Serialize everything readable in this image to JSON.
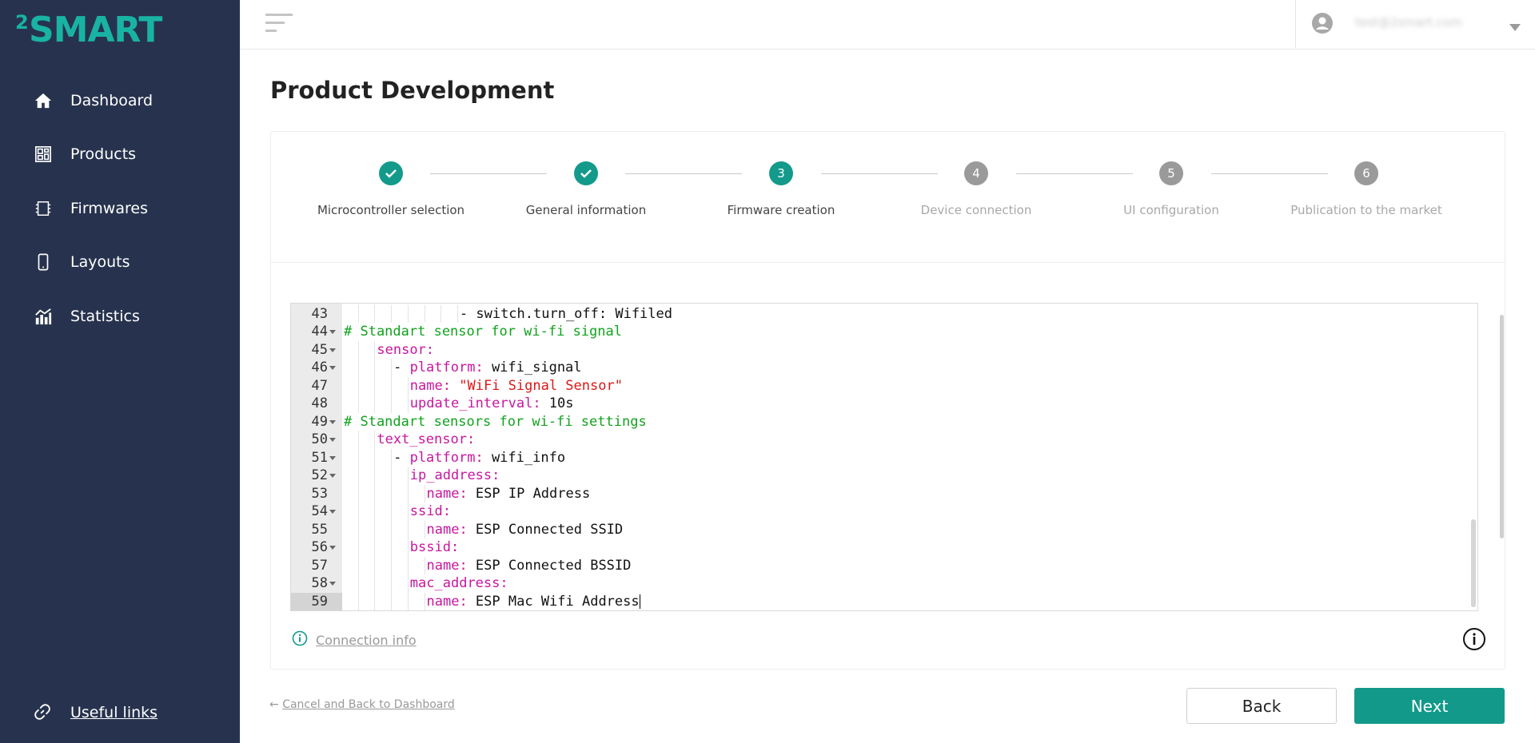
{
  "brand": {
    "superscript": "2",
    "name": "SMART",
    "accent": "#19b3a3"
  },
  "sidebar": {
    "items": [
      {
        "label": "Dashboard",
        "icon": "home-icon"
      },
      {
        "label": "Products",
        "icon": "products-icon"
      },
      {
        "label": "Firmwares",
        "icon": "chip-icon"
      },
      {
        "label": "Layouts",
        "icon": "phone-icon"
      },
      {
        "label": "Statistics",
        "icon": "chart-icon"
      }
    ],
    "footer_link": {
      "label": "Useful links",
      "icon": "link-icon"
    }
  },
  "header": {
    "user_email": "test@2smart.com"
  },
  "page": {
    "title": "Product Development"
  },
  "stepper": {
    "steps": [
      {
        "number": "1",
        "label": "Microcontroller selection",
        "state": "done"
      },
      {
        "number": "2",
        "label": "General information",
        "state": "done"
      },
      {
        "number": "3",
        "label": "Firmware creation",
        "state": "active"
      },
      {
        "number": "4",
        "label": "Device connection",
        "state": "pending"
      },
      {
        "number": "5",
        "label": "UI configuration",
        "state": "pending"
      },
      {
        "number": "6",
        "label": "Publication to the market",
        "state": "pending"
      }
    ]
  },
  "editor": {
    "lines": [
      {
        "n": "43",
        "fold": false,
        "indent": 7,
        "tokens": [
          [
            "plain",
            "- switch.turn_off: Wifiled"
          ]
        ]
      },
      {
        "n": "44",
        "fold": true,
        "indent": 0,
        "tokens": [
          [
            "comment",
            "# Standart sensor for wi-fi signal"
          ]
        ]
      },
      {
        "n": "45",
        "fold": true,
        "indent": 2,
        "tokens": [
          [
            "key",
            "sensor:"
          ]
        ]
      },
      {
        "n": "46",
        "fold": true,
        "indent": 3,
        "tokens": [
          [
            "plain",
            "- "
          ],
          [
            "key",
            "platform:"
          ],
          [
            "plain",
            " wifi_signal"
          ]
        ]
      },
      {
        "n": "47",
        "fold": false,
        "indent": 4,
        "tokens": [
          [
            "key",
            "name:"
          ],
          [
            "plain",
            " "
          ],
          [
            "str",
            "\"WiFi Signal Sensor\""
          ]
        ]
      },
      {
        "n": "48",
        "fold": false,
        "indent": 4,
        "tokens": [
          [
            "key",
            "update_interval:"
          ],
          [
            "plain",
            " 10s"
          ]
        ]
      },
      {
        "n": "49",
        "fold": true,
        "indent": 0,
        "tokens": [
          [
            "comment",
            "# Standart sensors for wi-fi settings"
          ]
        ]
      },
      {
        "n": "50",
        "fold": true,
        "indent": 2,
        "tokens": [
          [
            "key",
            "text_sensor:"
          ]
        ]
      },
      {
        "n": "51",
        "fold": true,
        "indent": 3,
        "tokens": [
          [
            "plain",
            "- "
          ],
          [
            "key",
            "platform:"
          ],
          [
            "plain",
            " wifi_info"
          ]
        ]
      },
      {
        "n": "52",
        "fold": true,
        "indent": 4,
        "tokens": [
          [
            "key",
            "ip_address:"
          ]
        ]
      },
      {
        "n": "53",
        "fold": false,
        "indent": 5,
        "tokens": [
          [
            "key",
            "name:"
          ],
          [
            "plain",
            " ESP IP Address"
          ]
        ]
      },
      {
        "n": "54",
        "fold": true,
        "indent": 4,
        "tokens": [
          [
            "key",
            "ssid:"
          ]
        ]
      },
      {
        "n": "55",
        "fold": false,
        "indent": 5,
        "tokens": [
          [
            "key",
            "name:"
          ],
          [
            "plain",
            " ESP Connected SSID"
          ]
        ]
      },
      {
        "n": "56",
        "fold": true,
        "indent": 4,
        "tokens": [
          [
            "key",
            "bssid:"
          ]
        ]
      },
      {
        "n": "57",
        "fold": false,
        "indent": 5,
        "tokens": [
          [
            "key",
            "name:"
          ],
          [
            "plain",
            " ESP Connected BSSID"
          ]
        ]
      },
      {
        "n": "58",
        "fold": true,
        "indent": 4,
        "tokens": [
          [
            "key",
            "mac_address:"
          ]
        ]
      },
      {
        "n": "59",
        "fold": false,
        "indent": 5,
        "active": true,
        "tokens": [
          [
            "key",
            "name:"
          ],
          [
            "plain",
            " ESP Mac Wifi Address"
          ]
        ]
      }
    ]
  },
  "connection_info": {
    "label": "Connection info",
    "icon": "info-circle-icon"
  },
  "actions": {
    "cancel_arrow": "←",
    "cancel_label": "Cancel and Back to Dashboard",
    "back_label": "Back",
    "next_label": "Next"
  }
}
